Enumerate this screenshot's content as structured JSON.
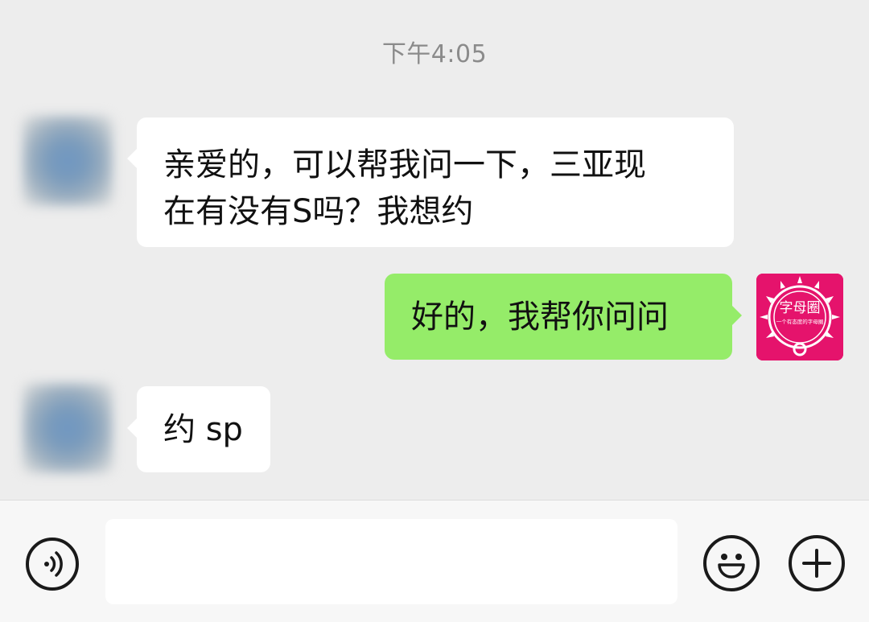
{
  "chat": {
    "timestamp": "下午4:05",
    "messages": [
      {
        "direction": "incoming",
        "lines": [
          "亲爱的，可以帮我问一下，三亚现",
          "在有没有S吗？我想约"
        ]
      },
      {
        "direction": "outgoing",
        "lines": [
          "好的，我帮你问问"
        ]
      },
      {
        "direction": "incoming",
        "lines": [
          "约 sp"
        ]
      }
    ],
    "self_avatar": {
      "logo_text": "字母圈",
      "logo_subtext": "一个有态度的字母圈",
      "color": "#e5136c"
    }
  },
  "input_bar": {
    "voice_icon": "voice-icon",
    "input_value": "",
    "emoji_icon": "emoji-icon",
    "plus_icon": "plus-icon"
  },
  "colors": {
    "background": "#ededed",
    "bubble_incoming": "#ffffff",
    "bubble_outgoing": "#95ec69",
    "bottom_bar": "#f7f7f7"
  }
}
